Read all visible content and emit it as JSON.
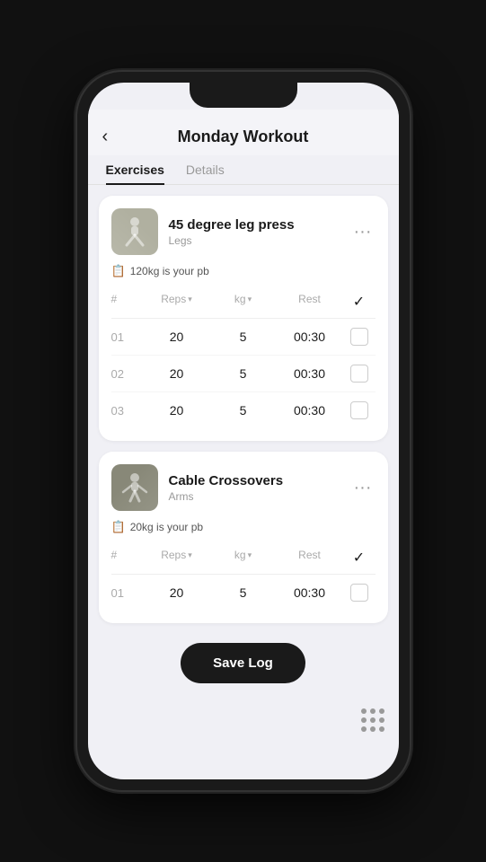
{
  "header": {
    "back_icon": "‹",
    "title": "Monday Workout"
  },
  "tabs": [
    {
      "label": "Exercises",
      "active": true
    },
    {
      "label": "Details",
      "active": false
    }
  ],
  "exercises": [
    {
      "id": "ex1",
      "name": "45 degree leg press",
      "muscle": "Legs",
      "pb_text": "120kg is your pb",
      "thumb_type": "leg",
      "sets": [
        {
          "num": "01",
          "reps": "20",
          "kg": "5",
          "rest": "00:30"
        },
        {
          "num": "02",
          "reps": "20",
          "kg": "5",
          "rest": "00:30"
        },
        {
          "num": "03",
          "reps": "20",
          "kg": "5",
          "rest": "00:30"
        }
      ]
    },
    {
      "id": "ex2",
      "name": "Cable Crossovers",
      "muscle": "Arms",
      "pb_text": "20kg is your pb",
      "thumb_type": "cable",
      "sets": [
        {
          "num": "01",
          "reps": "20",
          "kg": "5",
          "rest": "00:30"
        }
      ]
    }
  ],
  "table_headers": {
    "num": "#",
    "reps": "Reps",
    "kg": "kg",
    "rest": "Rest"
  },
  "save_log_label": "Save Log",
  "dots_count": 9
}
